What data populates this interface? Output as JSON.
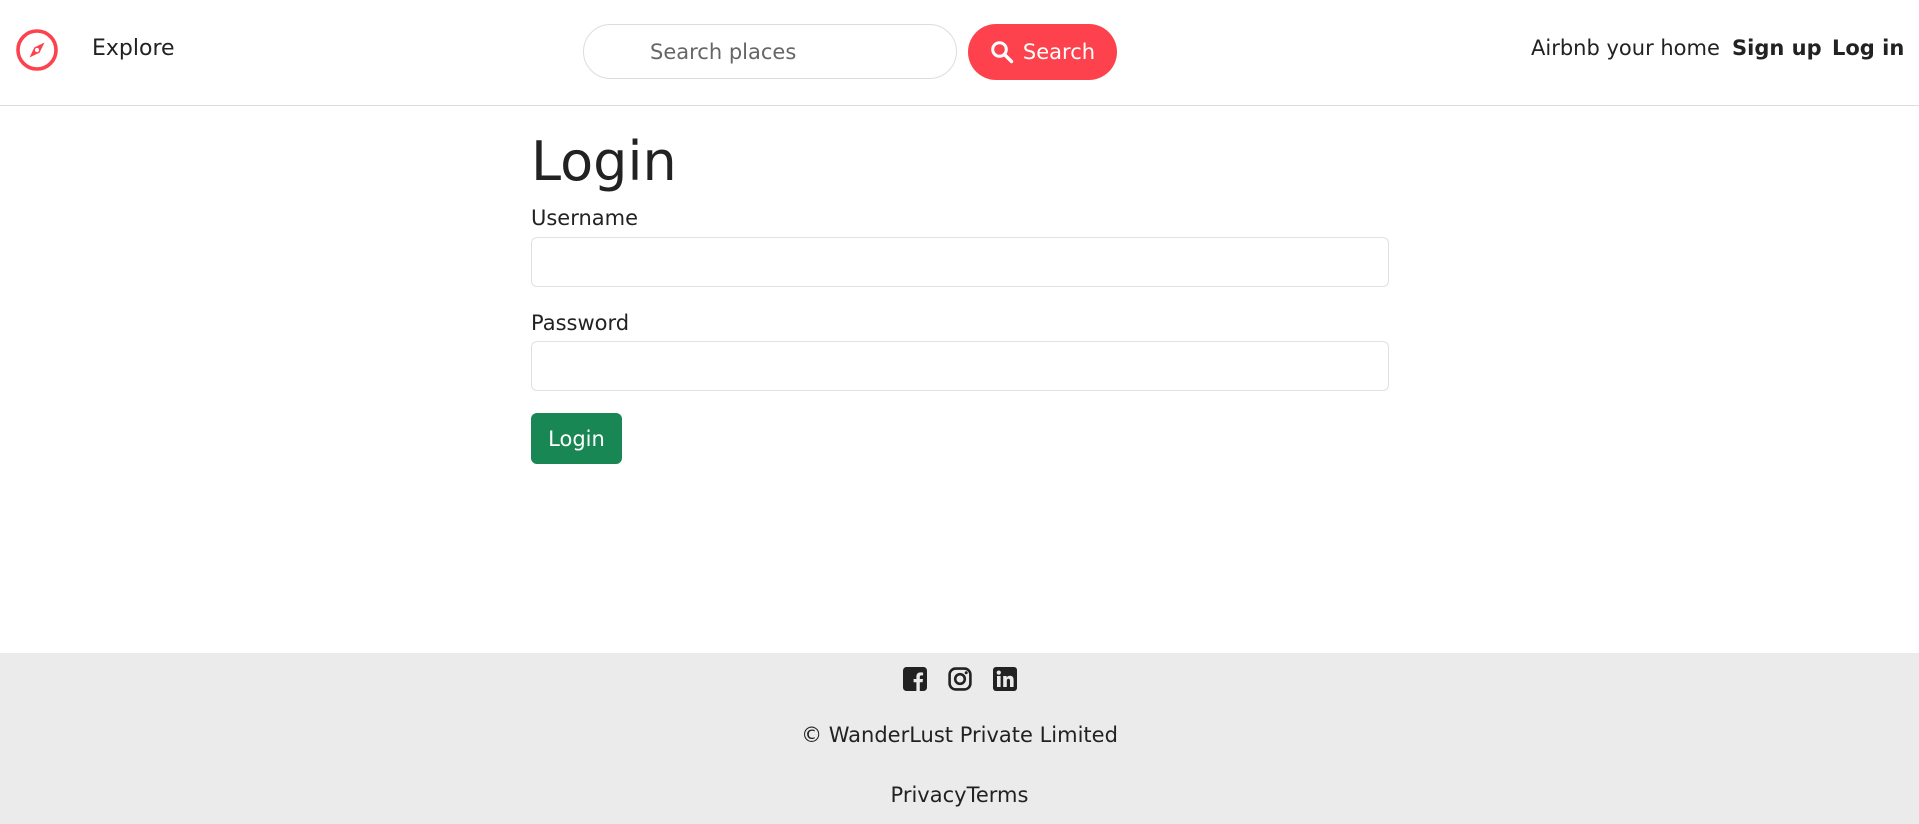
{
  "colors": {
    "brand": "#fe424d",
    "login_button": "#198754",
    "footer_background": "#ebebeb",
    "text": "#222222"
  },
  "navbar": {
    "logo_icon": "compass-icon",
    "explore_label": "Explore",
    "search": {
      "placeholder": "Search places",
      "value": "",
      "button_label": "Search",
      "button_icon": "magnifier-icon"
    },
    "host_label": "Airbnb your home",
    "signup_label": "Sign up",
    "login_label": "Log in"
  },
  "form": {
    "title": "Login",
    "username_label": "Username",
    "username_value": "",
    "password_label": "Password",
    "password_value": "",
    "submit_label": "Login"
  },
  "footer": {
    "social_icons": [
      "facebook-icon",
      "instagram-icon",
      "linkedin-icon"
    ],
    "copyright": "© WanderLust Private Limited",
    "privacy_label": "Privacy",
    "terms_label": "Terms"
  }
}
